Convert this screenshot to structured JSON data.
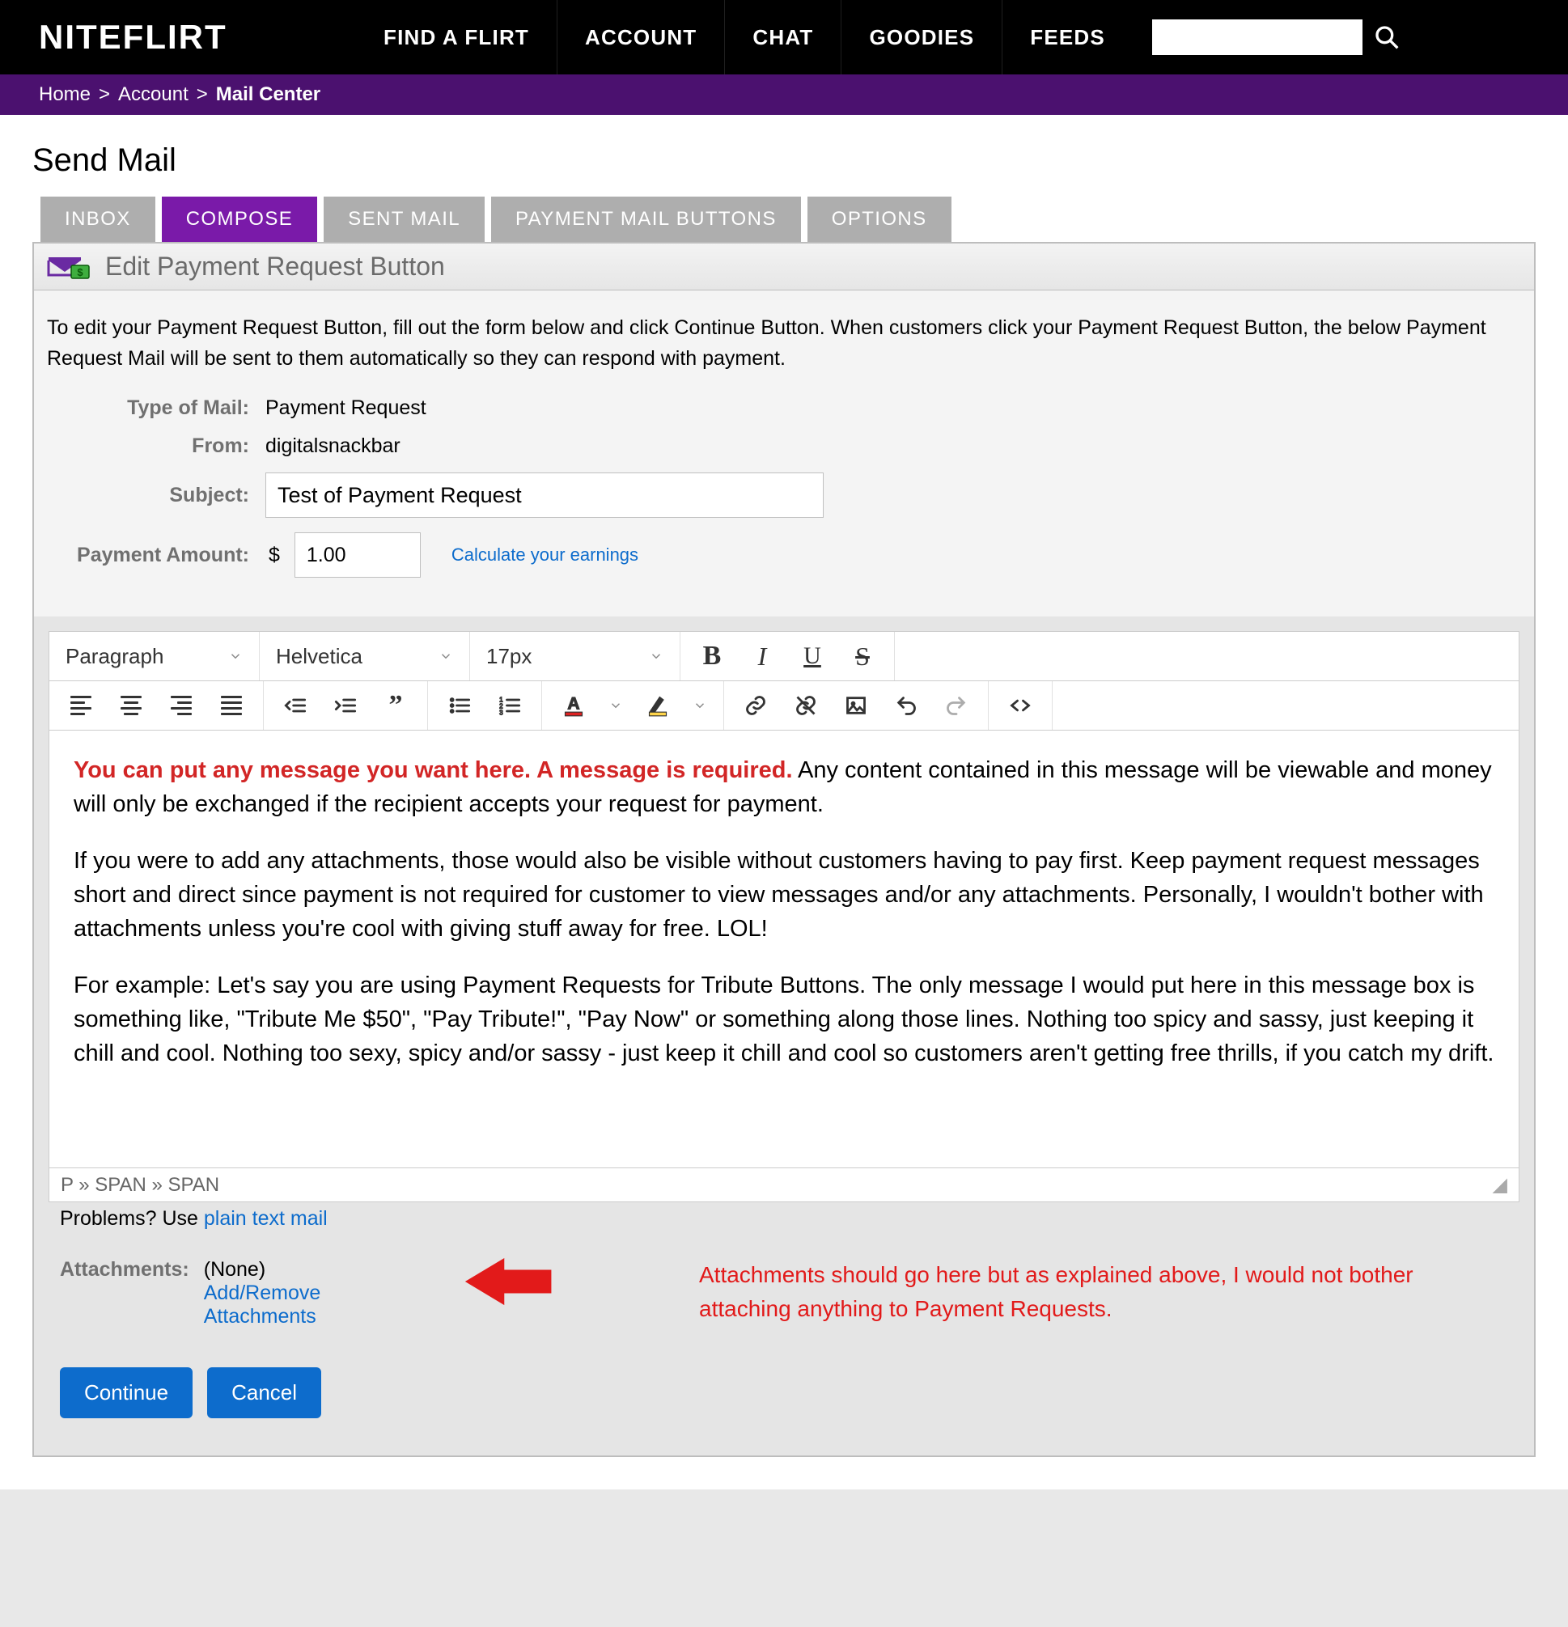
{
  "nav": {
    "logo": "NITEFLIRT",
    "items": [
      "FIND A FLIRT",
      "ACCOUNT",
      "CHAT",
      "GOODIES",
      "FEEDS"
    ],
    "search_placeholder": ""
  },
  "crumbs": {
    "home": "Home",
    "account": "Account",
    "current": "Mail Center"
  },
  "page_title": "Send Mail",
  "tabs": {
    "inbox": "INBOX",
    "compose": "COMPOSE",
    "sent": "SENT MAIL",
    "payment_buttons": "PAYMENT MAIL BUTTONS",
    "options": "OPTIONS",
    "active": "compose"
  },
  "panel": {
    "title": "Edit Payment Request Button",
    "help": "To edit your Payment Request Button, fill out the form below and click Continue Button. When customers click your Payment Request Button, the below Payment Request Mail will be sent to them automatically so they can respond with payment.",
    "labels": {
      "type": "Type of Mail:",
      "from": "From:",
      "subject": "Subject:",
      "amount": "Payment Amount:"
    },
    "values": {
      "type": "Payment Request",
      "from": "digitalsnackbar",
      "subject": "Test of Payment Request",
      "amount": "1.00",
      "currency": "$"
    },
    "calc_link": "Calculate your earnings"
  },
  "editor": {
    "block_format": "Paragraph",
    "font_family": "Helvetica",
    "font_size": "17px",
    "body": {
      "required_red": "You can put any message you want here. A message is required.",
      "p1_rest": " Any content contained in this message will be viewable and money will only be exchanged if the recipient accepts your request for payment.",
      "p2": "If you were to add any attachments, those would also be visible without customers having to pay first. Keep payment request messages short and direct since payment is not required for customer to view messages and/or any attachments. Personally, I wouldn't bother with attachments unless you're cool with giving stuff away for free. LOL!",
      "p3": "For example: Let's say you are using Payment Requests for Tribute Buttons. The only message I would put here in this message box is something like, \"Tribute Me $50\", \"Pay Tribute!\", \"Pay Now\" or something along those lines. Nothing too spicy and sassy, just keeping it chill and cool.  Nothing too sexy, spicy and/or sassy - just keep it chill and cool so customers aren't getting free thrills, if you catch my drift."
    },
    "path": "P  »  SPAN  »  SPAN"
  },
  "below": {
    "problems_prefix": "Problems? Use ",
    "problems_link": "plain text mail",
    "attachments_label": "Attachments:",
    "attachments_value": "(None)",
    "attachments_link": "Add/Remove Attachments",
    "annotation": "Attachments should go here but as explained above, I would not bother attaching anything to Payment Requests."
  },
  "buttons": {
    "continue": "Continue",
    "cancel": "Cancel"
  }
}
